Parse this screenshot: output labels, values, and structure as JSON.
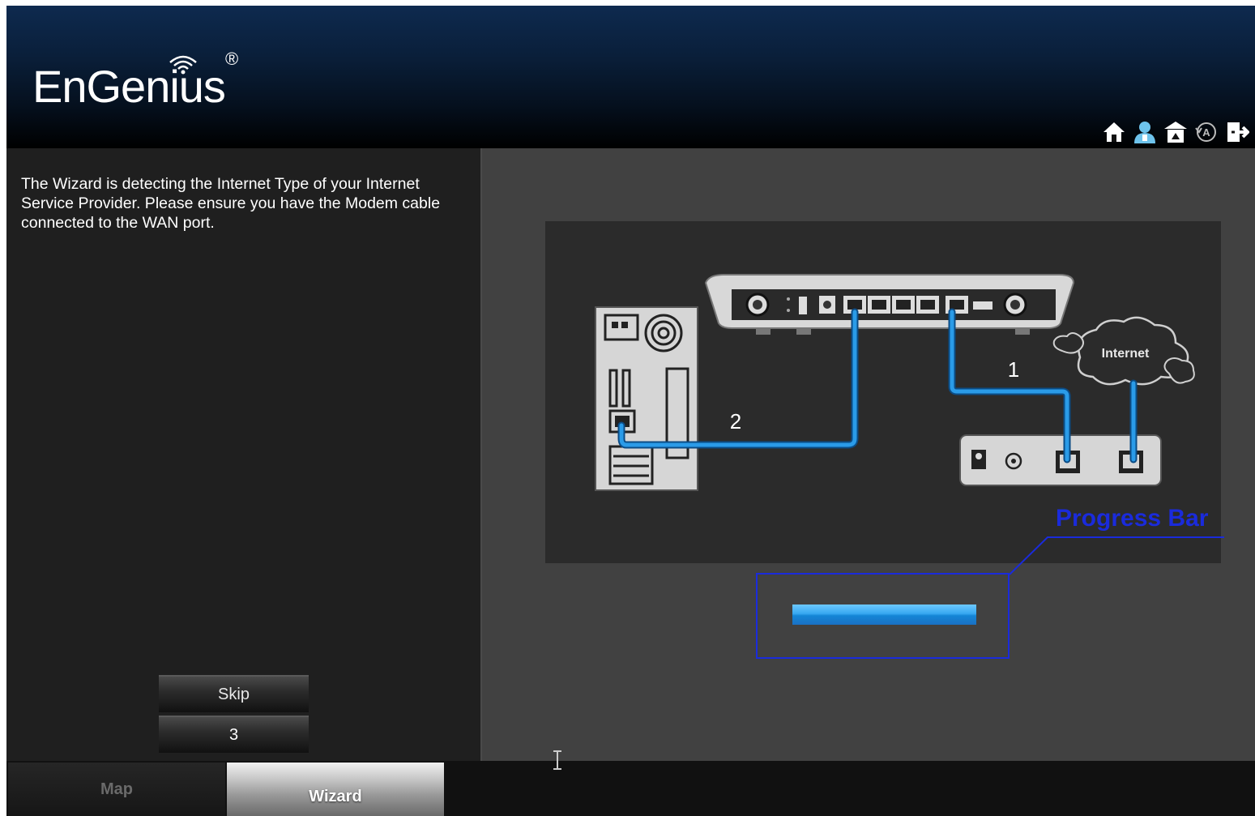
{
  "header": {
    "brand": "EnGenius",
    "brand_mark": "®",
    "icons": [
      "home-icon",
      "user-icon",
      "gateway-icon",
      "auto-icon",
      "logout-icon"
    ]
  },
  "wizard": {
    "message": "The Wizard is detecting the Internet Type of your Internet Service Provider. Please ensure you have the Modem cable connected to the WAN port.",
    "skip_label": "Skip",
    "countdown": "3"
  },
  "diagram": {
    "internet_label": "Internet",
    "cable_1_label": "1",
    "cable_2_label": "2"
  },
  "progress": {
    "annotation_label": "Progress Bar",
    "fraction": 1.0
  },
  "tabs": {
    "map_label": "Map",
    "wizard_label": "Wizard",
    "active": "Wizard"
  },
  "colors": {
    "annotation": "#1a2bdc",
    "cable": "#1e90e0",
    "header_top": "#0e2a4f",
    "panel_bg": "#414141"
  }
}
